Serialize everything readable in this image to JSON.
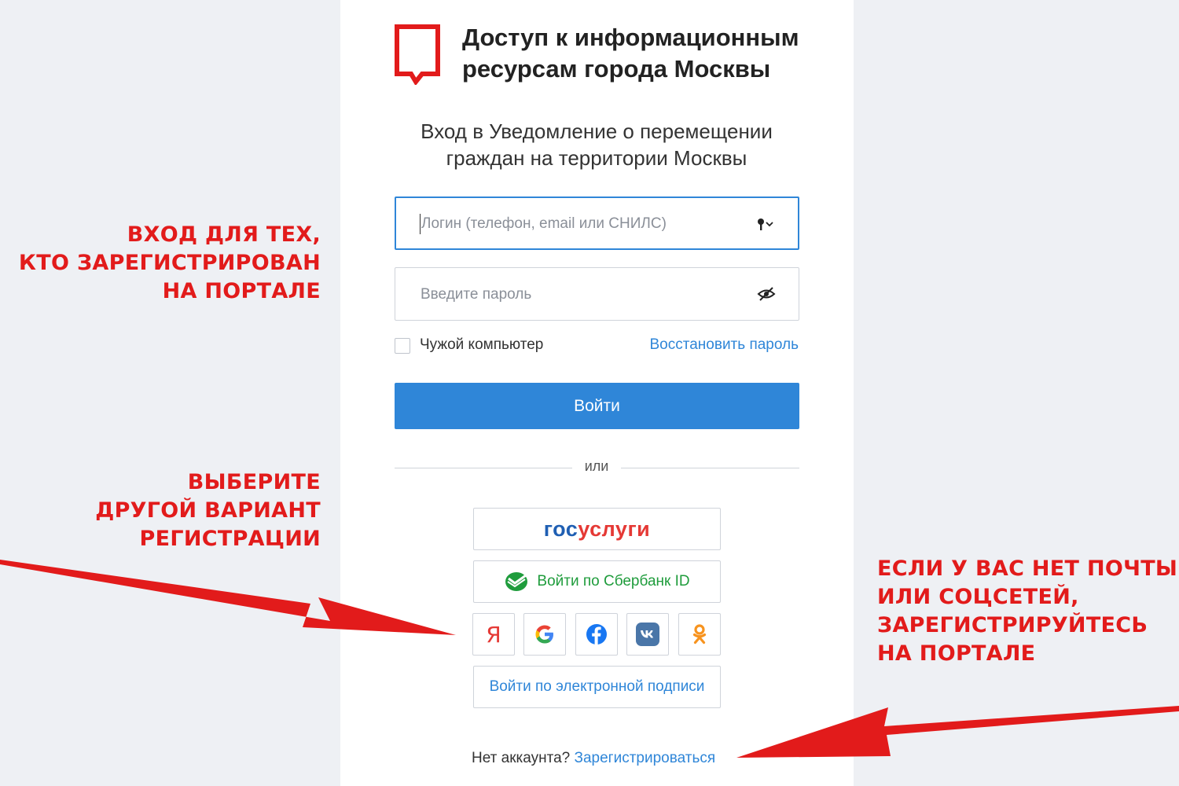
{
  "brand": {
    "title_line1": "Доступ к информационным",
    "title_line2": "ресурсам города Москвы"
  },
  "subtitle": {
    "line1": "Вход в Уведомление о перемещении",
    "line2": "граждан на территории Москвы"
  },
  "login_field": {
    "placeholder": "Логин (телефон, email или СНИЛС)",
    "value": ""
  },
  "password_field": {
    "placeholder": "Введите пароль",
    "value": ""
  },
  "foreign_computer": {
    "label": "Чужой компьютер",
    "checked": false
  },
  "restore_password": "Восстановить пароль",
  "login_button": "Войти",
  "or_label": "или",
  "gosuslugi": {
    "part1": "гос",
    "part2": "услуги"
  },
  "sber_button": "Войти по Сбербанк ID",
  "social": {
    "yandex": "Я"
  },
  "esign_button": "Войти по электронной подписи",
  "footer": {
    "no_account": "Нет аккаунта?",
    "register": "Зарегистрироваться"
  },
  "annotations": {
    "registered": [
      "ВХОД ДЛЯ ТЕХ,",
      "КТО ЗАРЕГИСТРИРОВАН",
      "НА ПОРТАЛЕ"
    ],
    "choose_other": [
      "ВЫБЕРИТЕ",
      "ДРУГОЙ ВАРИАНТ",
      "РЕГИСТРАЦИИ"
    ],
    "no_email": [
      "ЕСЛИ У ВАС НЕТ ПОЧТЫ",
      "ИЛИ СОЦСЕТЕЙ,",
      "ЗАРЕГИСТРИРУЙТЕСЬ",
      "НА ПОРТАЛЕ"
    ]
  },
  "colors": {
    "accent": "#2f86d8",
    "brand_red": "#e21b1b",
    "sber_green": "#1f9c3c",
    "gos_blue": "#1f5fb3",
    "gos_red": "#e53935",
    "background": "#eef0f4"
  }
}
